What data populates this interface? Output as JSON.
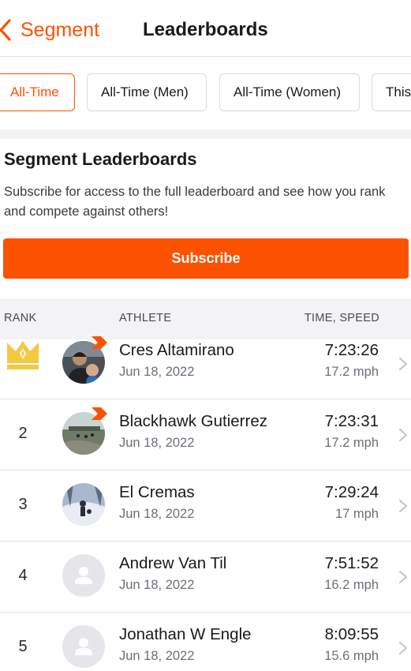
{
  "header": {
    "back_label": "Segment",
    "title": "Leaderboards"
  },
  "filters": [
    {
      "label": "All-Time",
      "active": true
    },
    {
      "label": "All-Time (Men)",
      "active": false
    },
    {
      "label": "All-Time (Women)",
      "active": false
    },
    {
      "label": "This",
      "active": false
    }
  ],
  "promo": {
    "title": "Segment Leaderboards",
    "text": "Subscribe for access to the full leaderboard and see how you rank and compete against others!",
    "button_label": "Subscribe"
  },
  "table": {
    "headers": {
      "rank": "RANK",
      "athlete": "ATHLETE",
      "time": "TIME, SPEED"
    },
    "rows": [
      {
        "rank": "1",
        "name": "Cres Altamirano",
        "date": "Jun 18, 2022",
        "time": "7:23:26",
        "speed": "17.2 mph"
      },
      {
        "rank": "2",
        "name": "Blackhawk Gutierrez",
        "date": "Jun 18, 2022",
        "time": "7:23:31",
        "speed": "17.2 mph"
      },
      {
        "rank": "3",
        "name": "El Cremas",
        "date": "Jun 18, 2022",
        "time": "7:29:24",
        "speed": "17 mph"
      },
      {
        "rank": "4",
        "name": "Andrew Van Til",
        "date": "Jun 18, 2022",
        "time": "7:51:52",
        "speed": "16.2 mph"
      },
      {
        "rank": "5",
        "name": "Jonathan W Engle",
        "date": "Jun 18, 2022",
        "time": "8:09:55",
        "speed": "15.6 mph"
      }
    ]
  },
  "colors": {
    "accent": "#fc5200",
    "crown": "#f5c842",
    "band": "#f3f3f5"
  },
  "icons": {
    "back": "chevron-left-icon",
    "row": "chevron-right-icon",
    "leader": "crown-icon",
    "subscriber": "subscriber-badge-icon",
    "placeholder": "default-avatar-icon"
  }
}
